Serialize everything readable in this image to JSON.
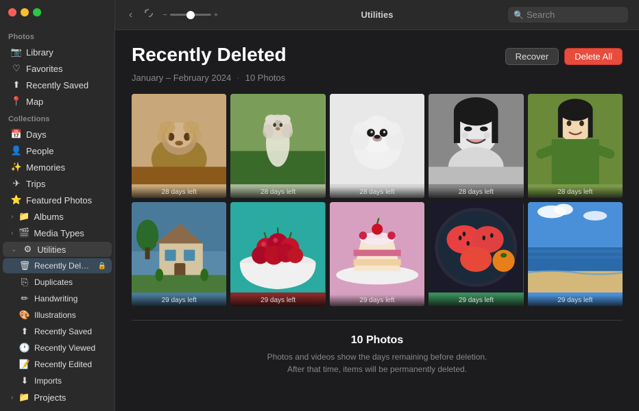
{
  "window": {
    "title": "Utilities"
  },
  "trafficLights": {
    "close": "close",
    "minimize": "minimize",
    "maximize": "maximize"
  },
  "toolbar": {
    "back_label": "‹",
    "rotate_label": "⟳",
    "zoom_minus": "−",
    "zoom_plus": "+",
    "title": "Utilities",
    "search_placeholder": "Search"
  },
  "sidebar": {
    "photos_section_label": "Photos",
    "collections_section_label": "Collections",
    "items_photos": [
      {
        "id": "library",
        "label": "Library",
        "icon": "📷"
      },
      {
        "id": "favorites",
        "label": "Favorites",
        "icon": "♡"
      },
      {
        "id": "recently-saved",
        "label": "Recently Saved",
        "icon": "⬆"
      },
      {
        "id": "map",
        "label": "Map",
        "icon": "📍"
      }
    ],
    "items_collections": [
      {
        "id": "days",
        "label": "Days",
        "icon": "📅"
      },
      {
        "id": "people",
        "label": "People",
        "icon": "👤"
      },
      {
        "id": "memories",
        "label": "Memories",
        "icon": "✨"
      },
      {
        "id": "trips",
        "label": "Trips",
        "icon": "✈"
      },
      {
        "id": "featured-photos",
        "label": "Featured Photos",
        "icon": "⭐"
      },
      {
        "id": "albums",
        "label": "Albums",
        "icon": "📁",
        "has_chevron": true
      },
      {
        "id": "media-types",
        "label": "Media Types",
        "icon": "🎬",
        "has_chevron": true
      },
      {
        "id": "utilities",
        "label": "Utilities",
        "icon": "⚙",
        "expanded": true
      }
    ],
    "utilities_sub_items": [
      {
        "id": "recently-deleted",
        "label": "Recently Delet...",
        "icon": "🗑",
        "active": true,
        "badge": "🔒"
      },
      {
        "id": "duplicates",
        "label": "Duplicates",
        "icon": "⎘"
      },
      {
        "id": "handwriting",
        "label": "Handwriting",
        "icon": "✏"
      },
      {
        "id": "illustrations",
        "label": "Illustrations",
        "icon": "🎨"
      },
      {
        "id": "recently-saved-sub",
        "label": "Recently Saved",
        "icon": "⬆"
      },
      {
        "id": "recently-viewed",
        "label": "Recently Viewed",
        "icon": "🕐"
      },
      {
        "id": "recently-edited",
        "label": "Recently Edited",
        "icon": "📝"
      },
      {
        "id": "imports",
        "label": "Imports",
        "icon": "⬇"
      }
    ],
    "projects_item": {
      "id": "projects",
      "label": "Projects",
      "icon": "📁",
      "has_chevron": true
    }
  },
  "main": {
    "page_title": "Recently Deleted",
    "date_range": "January – February 2024",
    "photo_count_meta": "10 Photos",
    "recover_label": "Recover",
    "delete_all_label": "Delete All",
    "photos": [
      {
        "id": 1,
        "days_left": "28 days left",
        "type": "dog1"
      },
      {
        "id": 2,
        "days_left": "28 days left",
        "type": "dog2"
      },
      {
        "id": 3,
        "days_left": "28 days left",
        "type": "dog3"
      },
      {
        "id": 4,
        "days_left": "28 days left",
        "type": "girl-bw"
      },
      {
        "id": 5,
        "days_left": "28 days left",
        "type": "girl-green"
      },
      {
        "id": 6,
        "days_left": "29 days left",
        "type": "house"
      },
      {
        "id": 7,
        "days_left": "29 days left",
        "type": "berries"
      },
      {
        "id": 8,
        "days_left": "29 days left",
        "type": "cake"
      },
      {
        "id": 9,
        "days_left": "29 days left",
        "type": "watermelon"
      },
      {
        "id": 10,
        "days_left": "29 days left",
        "type": "beach"
      }
    ],
    "bottom_count": "10 Photos",
    "bottom_desc_line1": "Photos and videos show the days remaining before deletion.",
    "bottom_desc_line2": "After that time, items will be permanently deleted."
  }
}
